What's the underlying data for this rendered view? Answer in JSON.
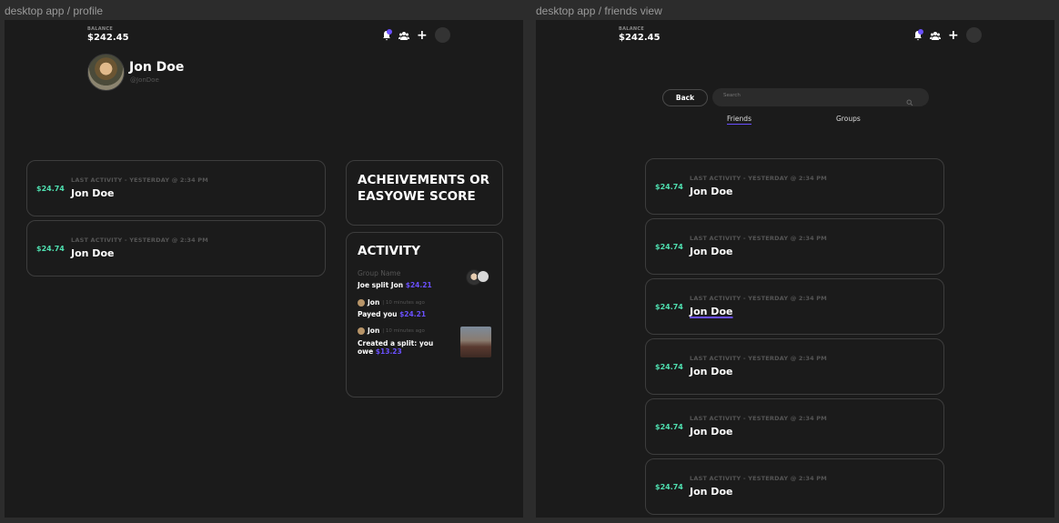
{
  "frames": {
    "profile_label": "desktop app / profile",
    "friends_label": "desktop app / friends view"
  },
  "header": {
    "balance_label": "BALANCE",
    "balance_value": "$242.45"
  },
  "icons": {
    "notifications": "bell-icon",
    "friends": "people-icon",
    "add": "plus-icon",
    "account": "avatar-icon"
  },
  "colors": {
    "accent": "#6a50ff",
    "amount_green": "#4fe0b0",
    "background": "#1b1b1b"
  },
  "profile": {
    "name": "Jon Doe",
    "handle": "@JonDoe",
    "activity_cards": [
      {
        "amount": "$24.74",
        "last_activity": "LAST ACTIVITY - YESTERDAY @ 2:34 PM",
        "name": "Jon Doe"
      },
      {
        "amount": "$24.74",
        "last_activity": "LAST ACTIVITY - YESTERDAY @ 2:34 PM",
        "name": "Jon Doe"
      }
    ],
    "achievements_title": "ACHEIVEMENTS OR EASYOWE SCORE",
    "activity": {
      "title": "ACTIVITY",
      "group_name": "Group Name",
      "item1_text": "Joe split Jon",
      "item1_amount": "$24.21",
      "item2_user": "Jon",
      "item2_time": "| 10 minutes ago",
      "item2_text": "Payed you",
      "item2_amount": "$24.21",
      "item3_user": "Jon",
      "item3_time": "| 10 minutes ago",
      "item3_text_a": "Created a split: you",
      "item3_text_b": "owe",
      "item3_amount": "$13.23"
    }
  },
  "friends_view": {
    "back_label": "Back",
    "search_placeholder": "Search",
    "tabs": [
      "Friends",
      "Groups"
    ],
    "friends": [
      {
        "amount": "$24.74",
        "last_activity": "LAST ACTIVITY - YESTERDAY @ 2:34 PM",
        "name": "Jon Doe"
      },
      {
        "amount": "$24.74",
        "last_activity": "LAST ACTIVITY - YESTERDAY @ 2:34 PM",
        "name": "Jon Doe"
      },
      {
        "amount": "$24.74",
        "last_activity": "LAST ACTIVITY - YESTERDAY @ 2:34 PM",
        "name": "Jon Doe"
      },
      {
        "amount": "$24.74",
        "last_activity": "LAST ACTIVITY - YESTERDAY @ 2:34 PM",
        "name": "Jon Doe"
      },
      {
        "amount": "$24.74",
        "last_activity": "LAST ACTIVITY - YESTERDAY @ 2:34 PM",
        "name": "Jon Doe"
      },
      {
        "amount": "$24.74",
        "last_activity": "LAST ACTIVITY - YESTERDAY @ 2:34 PM",
        "name": "Jon Doe"
      }
    ]
  }
}
